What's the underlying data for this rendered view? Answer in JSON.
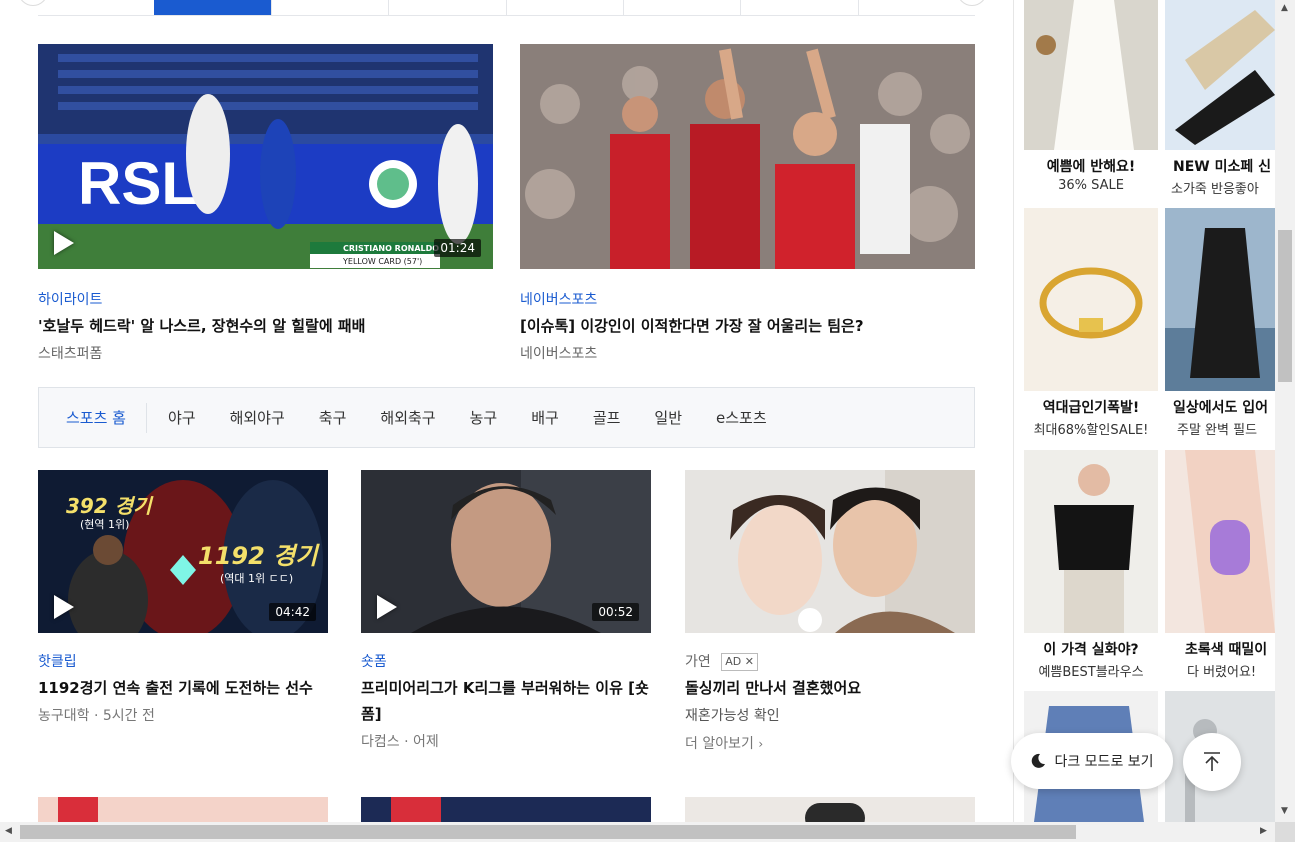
{
  "big_cards": [
    {
      "category": "하이라이트",
      "title": "'호날두 헤드락' 알 나스르, 장현수의 알 힐랄에 패배",
      "source": "스태츠퍼폼",
      "duration": "01:24",
      "thumb_caption": "CRISTIANO RONALDO",
      "thumb_sub": "YELLOW CARD (57')"
    },
    {
      "category": "네이버스포츠",
      "title": "[이슈톡] 이강인이 이적한다면 가장 잘 어울리는 팀은?",
      "source": "네이버스포츠"
    }
  ],
  "sport_nav": [
    "스포츠 홈",
    "야구",
    "해외야구",
    "축구",
    "해외축구",
    "농구",
    "배구",
    "골프",
    "일반",
    "e스포츠"
  ],
  "small_cards": [
    {
      "category": "핫클립",
      "title": "1192경기 연속 출전 기록에 도전하는 선수",
      "meta": "농구대학 · 5시간 전",
      "duration": "04:42",
      "overlay1": "392 경기",
      "overlay1_sub": "(현역 1위)",
      "overlay2": "1192 경기",
      "overlay2_sub": "(역대 1위 ㄷㄷ)"
    },
    {
      "category": "숏폼",
      "title": "프리미어리그가 K리그를 부러워하는 이유 [숏폼]",
      "meta": "다컴스 · 어제",
      "duration": "00:52"
    },
    {
      "category": "가연",
      "ad_label": "AD",
      "title": "돌싱끼리 만나서 결혼했어요",
      "meta": "재혼가능성 확인",
      "more": "더 알아보기"
    }
  ],
  "shop_items": [
    {
      "name": "예쁨에 반해요!",
      "desc": "36% SALE"
    },
    {
      "name": "NEW 미소페 신",
      "desc": "소가죽 반응좋아"
    },
    {
      "name": "역대급인기폭발!",
      "desc": "최대68%할인SALE!"
    },
    {
      "name": "일상에서도 입어",
      "desc": "주말 완벽 필드"
    },
    {
      "name": "이 가격 실화야?",
      "desc": "예쁨BEST블라우스"
    },
    {
      "name": "초록색 때밀이",
      "desc": "다 버렸어요!"
    }
  ],
  "dark_mode_label": "다크 모드로 보기",
  "colors": {
    "accent": "#1a5bd0"
  }
}
